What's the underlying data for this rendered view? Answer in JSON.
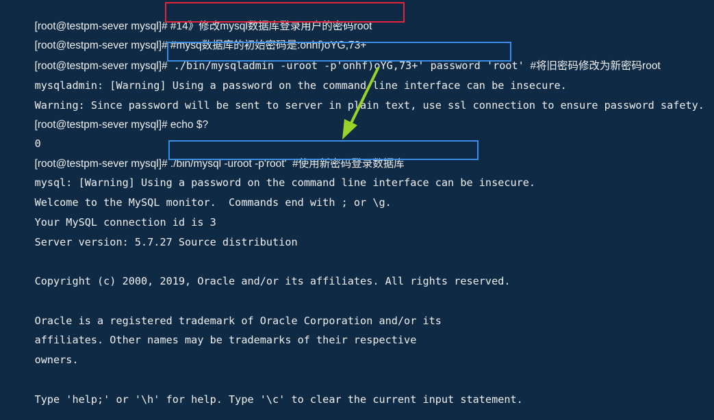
{
  "terminal": {
    "lines": [
      {
        "prompt": "[root@testpm-sever mysql]#",
        "cmd": " #14》修改mysql数据库登录用户的密码root"
      },
      {
        "prompt": "[root@testpm-sever mysql]#",
        "cmd": " #mysq数据库的初始密码是:onhf)oYG,73+"
      },
      {
        "prompt": "[root@testpm-sever mysql]#",
        "cmd": " ./bin/mysqladmin -uroot -p'onhf)oYG,73+' password 'root'",
        "comment": "  #将旧密码修改为新密码root"
      },
      {
        "text": "mysqladmin: [Warning] Using a password on the command line interface can be insecure."
      },
      {
        "text": "Warning: Since password will be sent to server in plain text, use ssl connection to ensure password safety."
      },
      {
        "prompt": "[root@testpm-sever mysql]#",
        "cmd": " echo $?"
      },
      {
        "text": "0"
      },
      {
        "prompt": "[root@testpm-sever mysql]#",
        "cmd": " ./bin/mysql -uroot -p'root'  #使用新密码登录数据库"
      },
      {
        "text": "mysql: [Warning] Using a password on the command line interface can be insecure."
      },
      {
        "text": "Welcome to the MySQL monitor.  Commands end with ; or \\g."
      },
      {
        "text": "Your MySQL connection id is 3"
      },
      {
        "text": "Server version: 5.7.27 Source distribution"
      },
      {
        "text": ""
      },
      {
        "text": "Copyright (c) 2000, 2019, Oracle and/or its affiliates. All rights reserved."
      },
      {
        "text": ""
      },
      {
        "text": "Oracle is a registered trademark of Oracle Corporation and/or its"
      },
      {
        "text": "affiliates. Other names may be trademarks of their respective"
      },
      {
        "text": "owners."
      },
      {
        "text": ""
      },
      {
        "text": "Type 'help;' or '\\h' for help. Type '\\c' to clear the current input statement."
      }
    ]
  },
  "colors": {
    "background": "#0f2a45",
    "text": "#f0f0f0",
    "annotation_red": "#e8243a",
    "annotation_blue": "#3a8ee6",
    "arrow_green": "#9bd22a"
  }
}
